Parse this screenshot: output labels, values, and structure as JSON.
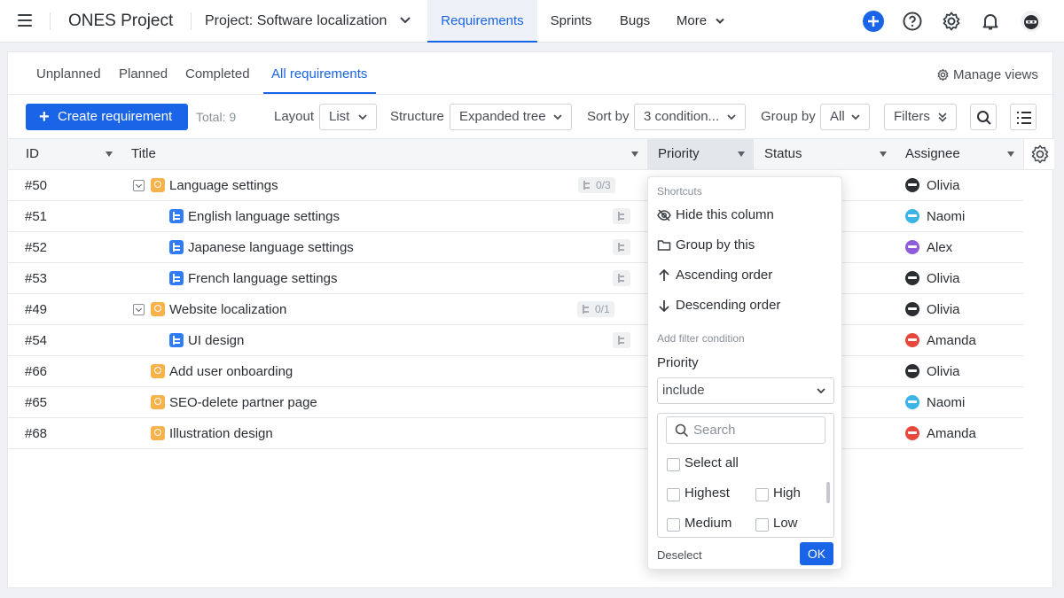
{
  "nav": {
    "app_title": "ONES Project",
    "project_label": "Project: Software localization",
    "tabs": [
      {
        "label": "Requirements",
        "active": true
      },
      {
        "label": "Sprints",
        "active": false
      },
      {
        "label": "Bugs",
        "active": false
      },
      {
        "label": "More",
        "active": false
      }
    ],
    "icons": [
      "add-icon",
      "help-icon",
      "settings-icon",
      "bell-icon",
      "user-avatar"
    ],
    "accent_color": "#1a64e8"
  },
  "subtabs": {
    "items": [
      {
        "label": "Unplanned",
        "active": false
      },
      {
        "label": "Planned",
        "active": false
      },
      {
        "label": "Completed",
        "active": false
      },
      {
        "label": "All requirements",
        "active": true
      }
    ],
    "manage_views": "Manage views"
  },
  "toolbar": {
    "create_label": "Create requirement",
    "total": "Total: 9",
    "layout_label": "Layout",
    "layout_value": "List",
    "structure_label": "Structure",
    "structure_value": "Expanded tree",
    "sort_label": "Sort by",
    "sort_value": "3 condition...",
    "group_label": "Group by",
    "group_value": "All",
    "filters_label": "Filters"
  },
  "table": {
    "columns": [
      "ID",
      "Title",
      "Priority",
      "Status",
      "Assignee"
    ],
    "rows": [
      {
        "id": "#50",
        "title": "Language settings",
        "children": "0/3",
        "assignee": "Olivia"
      },
      {
        "id": "#51",
        "title": "English language settings",
        "children": "",
        "assignee": "Naomi"
      },
      {
        "id": "#52",
        "title": "Japanese language settings",
        "children": "",
        "assignee": "Alex"
      },
      {
        "id": "#53",
        "title": "French language settings",
        "children": "",
        "assignee": "Olivia"
      },
      {
        "id": "#49",
        "title": "Website localization",
        "children": "0/1",
        "assignee": "Olivia"
      },
      {
        "id": "#54",
        "title": "UI design",
        "children": "",
        "assignee": "Amanda"
      },
      {
        "id": "#66",
        "title": "Add user onboarding",
        "children": "",
        "assignee": "Olivia"
      },
      {
        "id": "#65",
        "title": "SEO-delete partner page",
        "children": "",
        "assignee": "Naomi"
      },
      {
        "id": "#68",
        "title": "Illustration design",
        "children": "",
        "assignee": "Amanda"
      }
    ],
    "avatar_colors": {
      "Olivia": "#2b2f33",
      "Naomi": "#3cb4e6",
      "Alex": "#8e5bd9",
      "Amanda": "#e8483b"
    }
  },
  "dropdown": {
    "shortcuts_heading": "Shortcuts",
    "hide_column": "Hide this column",
    "group_by_this": "Group by this",
    "ascending": "Ascending order",
    "descending": "Descending order",
    "filter_heading": "Add filter condition",
    "filter_field": "Priority",
    "operator": "include",
    "search_placeholder": "Search",
    "select_all": "Select all",
    "options": [
      "Highest",
      "High",
      "Medium",
      "Low"
    ],
    "deselect": "Deselect",
    "ok": "OK"
  }
}
